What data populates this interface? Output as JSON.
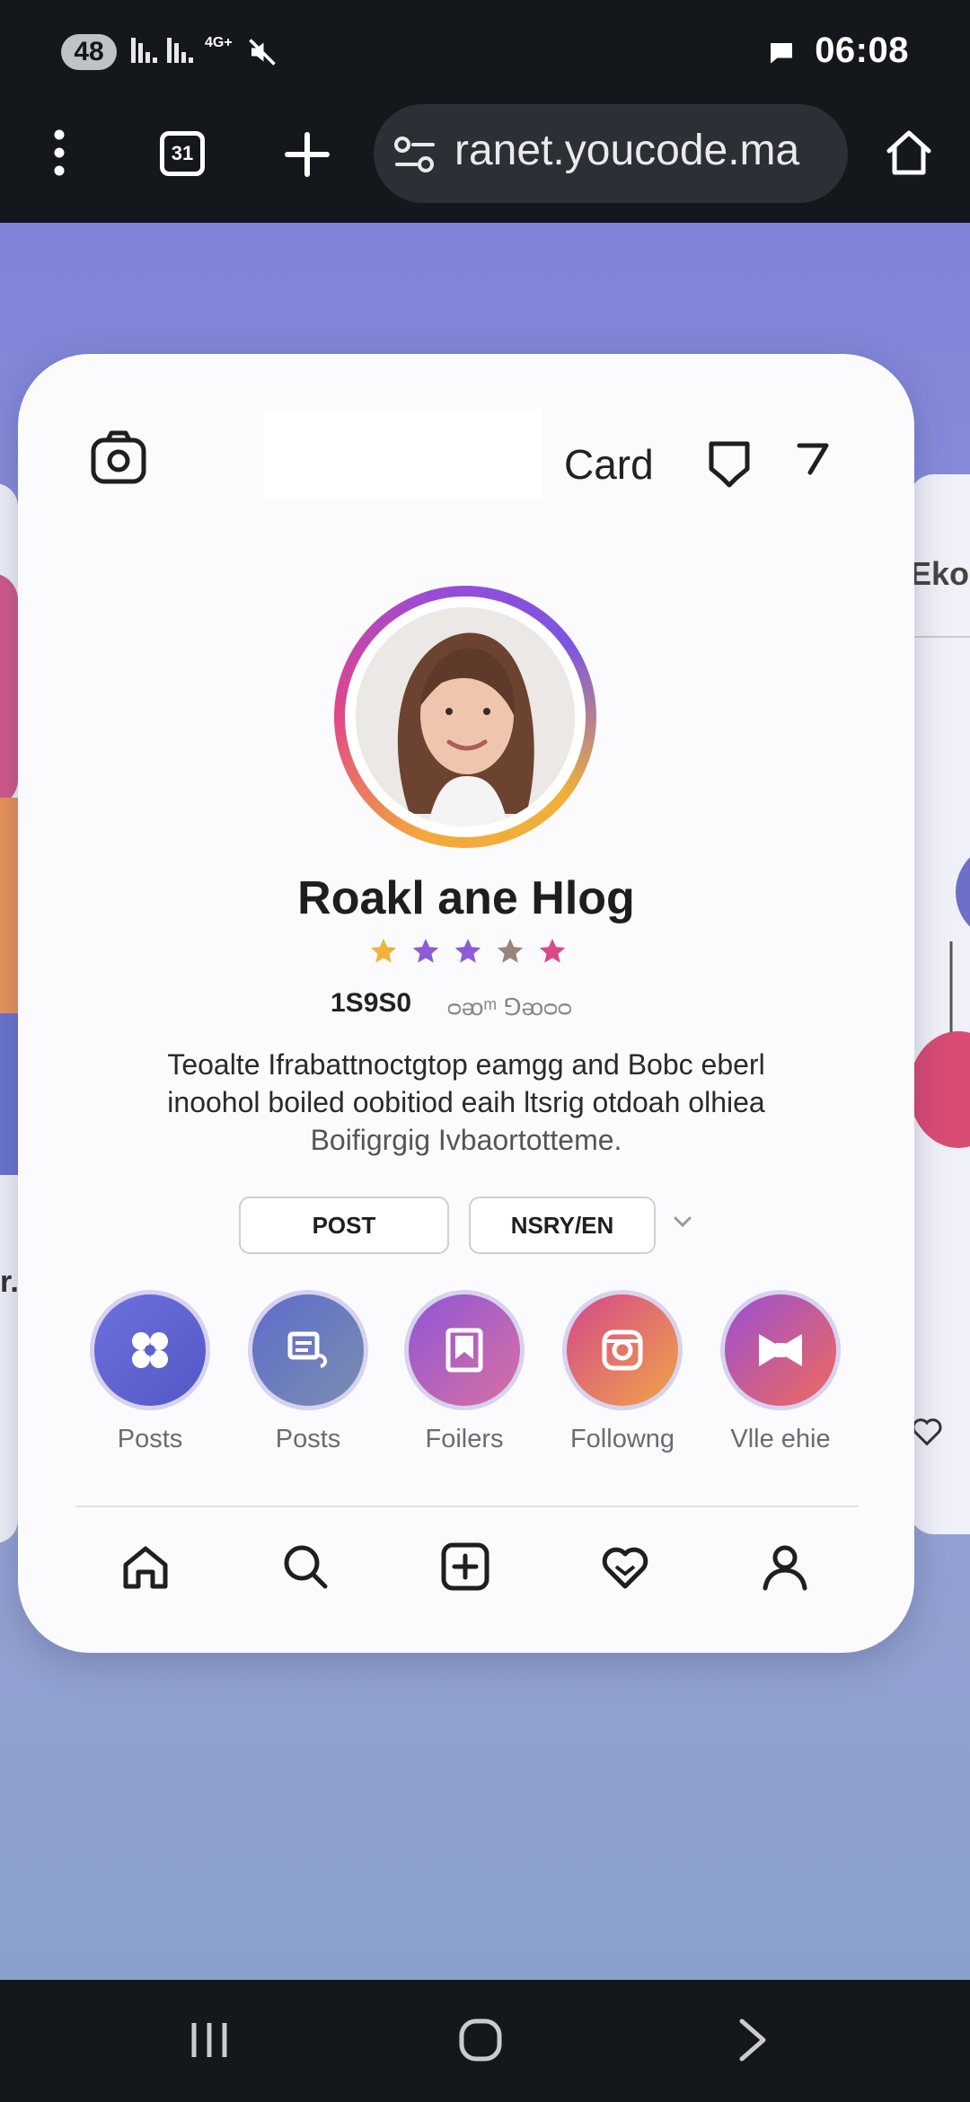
{
  "status_bar": {
    "battery": "48",
    "network": "4G+",
    "time": "06:08"
  },
  "browser": {
    "tab_count": "31",
    "url": "ranet.youcode.ma"
  },
  "card": {
    "header_title": "Card",
    "profile_name": "Roakl ane Hlog",
    "stars": [
      "#f0b43c",
      "#8f5bd6",
      "#8f5bd6",
      "#9a857c",
      "#d9498a"
    ],
    "stat_value": "1S9S0",
    "stat_sub": "ᴑᴔᵐ ⅁ᴔᴑᴑ",
    "bio_line1": "Teoalte Ifrabattnoctgtop eamgg and Bobc eberl",
    "bio_line2": "inoohol boiled oobitiod eaih ltsrig otdoah olhiea",
    "bio_line3": "Boifigrgig Ivbaortotteme.",
    "btn_post": "POST",
    "btn_second": "NSRY/EN",
    "highlights": [
      {
        "label": "Posts",
        "icon": "clover-icon",
        "color": "#5e62d0"
      },
      {
        "label": "Posts",
        "icon": "document-icon",
        "color": "#6576b8"
      },
      {
        "label": "Foilers",
        "icon": "bookmark-icon",
        "color": "#b45acb"
      },
      {
        "label": "Followng",
        "icon": "instagram-icon",
        "color": "#e4606c"
      },
      {
        "label": "Vlle ehie",
        "icon": "bow-icon",
        "color": "#e05876"
      }
    ]
  },
  "side_card_right": {
    "fragment": "Eko"
  },
  "side_card_left": {
    "fragment": "r."
  }
}
